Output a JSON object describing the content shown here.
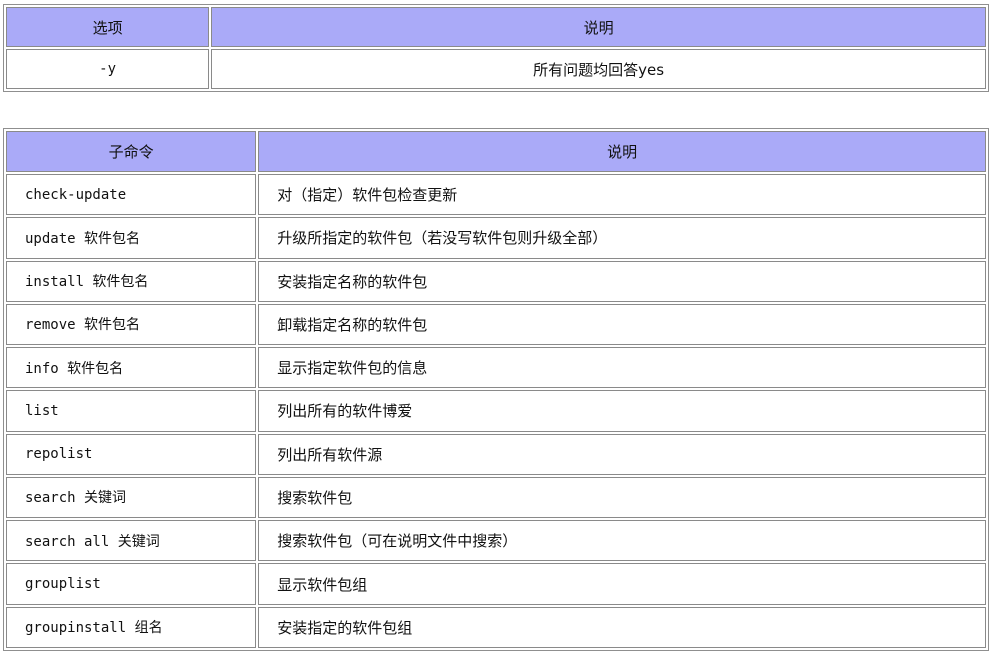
{
  "options_table": {
    "headers": [
      "选项",
      "说明"
    ],
    "rows": [
      {
        "option": "-y",
        "description": "所有问题均回答yes"
      }
    ]
  },
  "subcommands_table": {
    "headers": [
      "子命令",
      "说明"
    ],
    "rows": [
      {
        "command": "check-update",
        "description": "对（指定）软件包检查更新"
      },
      {
        "command": "update 软件包名",
        "description": "升级所指定的软件包（若没写软件包则升级全部）"
      },
      {
        "command": "install 软件包名",
        "description": "安装指定名称的软件包"
      },
      {
        "command": "remove 软件包名",
        "description": "卸载指定名称的软件包"
      },
      {
        "command": "info 软件包名",
        "description": "显示指定软件包的信息"
      },
      {
        "command": "list",
        "description": "列出所有的软件博爱"
      },
      {
        "command": "repolist",
        "description": "列出所有软件源"
      },
      {
        "command": "search 关键词",
        "description": "搜索软件包"
      },
      {
        "command": "search all 关键词",
        "description": "搜索软件包（可在说明文件中搜索）"
      },
      {
        "command": "grouplist",
        "description": "显示软件包组"
      },
      {
        "command": "groupinstall 组名",
        "description": "安装指定的软件包组"
      }
    ]
  },
  "colors": {
    "header_background": "#aaaaf8",
    "border": "#8a8a8a"
  }
}
